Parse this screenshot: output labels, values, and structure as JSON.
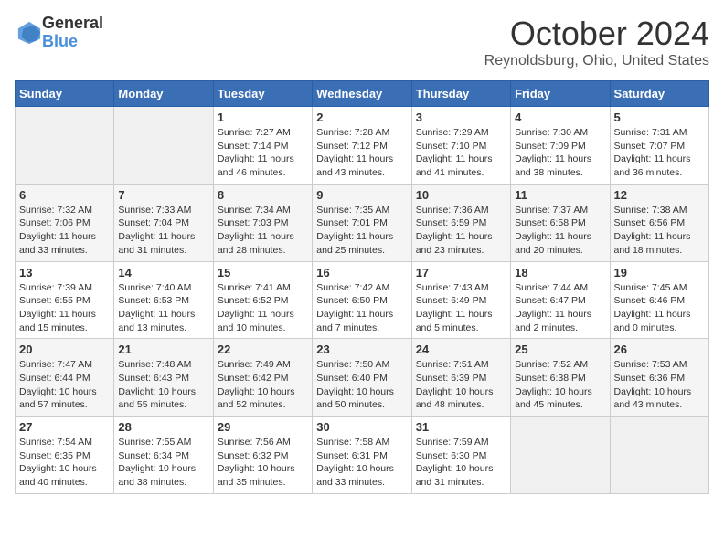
{
  "header": {
    "logo_line1": "General",
    "logo_line2": "Blue",
    "month": "October 2024",
    "location": "Reynoldsburg, Ohio, United States"
  },
  "weekdays": [
    "Sunday",
    "Monday",
    "Tuesday",
    "Wednesday",
    "Thursday",
    "Friday",
    "Saturday"
  ],
  "weeks": [
    [
      {
        "day": "",
        "info": ""
      },
      {
        "day": "",
        "info": ""
      },
      {
        "day": "1",
        "info": "Sunrise: 7:27 AM\nSunset: 7:14 PM\nDaylight: 11 hours and 46 minutes."
      },
      {
        "day": "2",
        "info": "Sunrise: 7:28 AM\nSunset: 7:12 PM\nDaylight: 11 hours and 43 minutes."
      },
      {
        "day": "3",
        "info": "Sunrise: 7:29 AM\nSunset: 7:10 PM\nDaylight: 11 hours and 41 minutes."
      },
      {
        "day": "4",
        "info": "Sunrise: 7:30 AM\nSunset: 7:09 PM\nDaylight: 11 hours and 38 minutes."
      },
      {
        "day": "5",
        "info": "Sunrise: 7:31 AM\nSunset: 7:07 PM\nDaylight: 11 hours and 36 minutes."
      }
    ],
    [
      {
        "day": "6",
        "info": "Sunrise: 7:32 AM\nSunset: 7:06 PM\nDaylight: 11 hours and 33 minutes."
      },
      {
        "day": "7",
        "info": "Sunrise: 7:33 AM\nSunset: 7:04 PM\nDaylight: 11 hours and 31 minutes."
      },
      {
        "day": "8",
        "info": "Sunrise: 7:34 AM\nSunset: 7:03 PM\nDaylight: 11 hours and 28 minutes."
      },
      {
        "day": "9",
        "info": "Sunrise: 7:35 AM\nSunset: 7:01 PM\nDaylight: 11 hours and 25 minutes."
      },
      {
        "day": "10",
        "info": "Sunrise: 7:36 AM\nSunset: 6:59 PM\nDaylight: 11 hours and 23 minutes."
      },
      {
        "day": "11",
        "info": "Sunrise: 7:37 AM\nSunset: 6:58 PM\nDaylight: 11 hours and 20 minutes."
      },
      {
        "day": "12",
        "info": "Sunrise: 7:38 AM\nSunset: 6:56 PM\nDaylight: 11 hours and 18 minutes."
      }
    ],
    [
      {
        "day": "13",
        "info": "Sunrise: 7:39 AM\nSunset: 6:55 PM\nDaylight: 11 hours and 15 minutes."
      },
      {
        "day": "14",
        "info": "Sunrise: 7:40 AM\nSunset: 6:53 PM\nDaylight: 11 hours and 13 minutes."
      },
      {
        "day": "15",
        "info": "Sunrise: 7:41 AM\nSunset: 6:52 PM\nDaylight: 11 hours and 10 minutes."
      },
      {
        "day": "16",
        "info": "Sunrise: 7:42 AM\nSunset: 6:50 PM\nDaylight: 11 hours and 7 minutes."
      },
      {
        "day": "17",
        "info": "Sunrise: 7:43 AM\nSunset: 6:49 PM\nDaylight: 11 hours and 5 minutes."
      },
      {
        "day": "18",
        "info": "Sunrise: 7:44 AM\nSunset: 6:47 PM\nDaylight: 11 hours and 2 minutes."
      },
      {
        "day": "19",
        "info": "Sunrise: 7:45 AM\nSunset: 6:46 PM\nDaylight: 11 hours and 0 minutes."
      }
    ],
    [
      {
        "day": "20",
        "info": "Sunrise: 7:47 AM\nSunset: 6:44 PM\nDaylight: 10 hours and 57 minutes."
      },
      {
        "day": "21",
        "info": "Sunrise: 7:48 AM\nSunset: 6:43 PM\nDaylight: 10 hours and 55 minutes."
      },
      {
        "day": "22",
        "info": "Sunrise: 7:49 AM\nSunset: 6:42 PM\nDaylight: 10 hours and 52 minutes."
      },
      {
        "day": "23",
        "info": "Sunrise: 7:50 AM\nSunset: 6:40 PM\nDaylight: 10 hours and 50 minutes."
      },
      {
        "day": "24",
        "info": "Sunrise: 7:51 AM\nSunset: 6:39 PM\nDaylight: 10 hours and 48 minutes."
      },
      {
        "day": "25",
        "info": "Sunrise: 7:52 AM\nSunset: 6:38 PM\nDaylight: 10 hours and 45 minutes."
      },
      {
        "day": "26",
        "info": "Sunrise: 7:53 AM\nSunset: 6:36 PM\nDaylight: 10 hours and 43 minutes."
      }
    ],
    [
      {
        "day": "27",
        "info": "Sunrise: 7:54 AM\nSunset: 6:35 PM\nDaylight: 10 hours and 40 minutes."
      },
      {
        "day": "28",
        "info": "Sunrise: 7:55 AM\nSunset: 6:34 PM\nDaylight: 10 hours and 38 minutes."
      },
      {
        "day": "29",
        "info": "Sunrise: 7:56 AM\nSunset: 6:32 PM\nDaylight: 10 hours and 35 minutes."
      },
      {
        "day": "30",
        "info": "Sunrise: 7:58 AM\nSunset: 6:31 PM\nDaylight: 10 hours and 33 minutes."
      },
      {
        "day": "31",
        "info": "Sunrise: 7:59 AM\nSunset: 6:30 PM\nDaylight: 10 hours and 31 minutes."
      },
      {
        "day": "",
        "info": ""
      },
      {
        "day": "",
        "info": ""
      }
    ]
  ]
}
